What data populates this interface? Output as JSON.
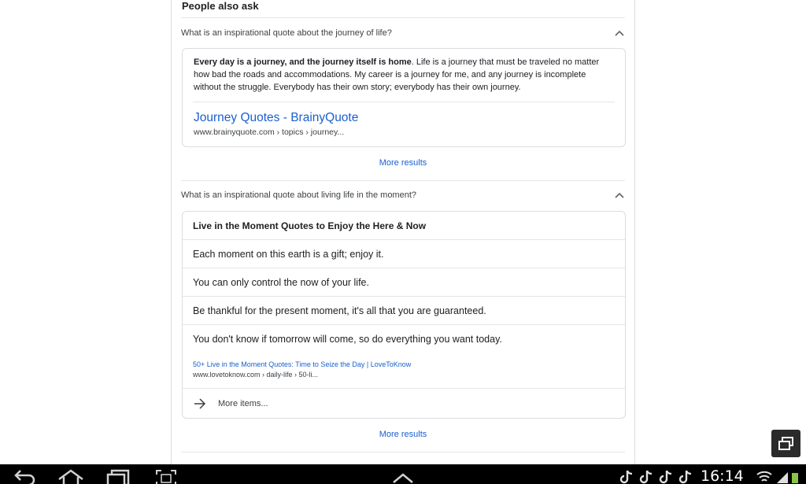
{
  "paa": {
    "title": "People also ask",
    "more_results_label": "More results",
    "q1": {
      "question": "What is an inspirational quote about the journey of life?",
      "snippet_bold": "Every day is a journey, and the journey itself is home",
      "snippet_rest": ". Life is a journey that must be traveled no matter how bad the roads and accommodations. My career is a journey for me, and any journey is incomplete without the struggle. Everybody has their own story; everybody has their own journey.",
      "source_title": "Journey Quotes - BrainyQuote",
      "source_url": "www.brainyquote.com › topics › journey..."
    },
    "q2": {
      "question": "What is an inspirational quote about living life in the moment?",
      "list_header": "Live in the Moment Quotes to Enjoy the Here & Now",
      "items": [
        "Each moment on this earth is a gift; enjoy it.",
        "You can only control the now of your life.",
        "Be thankful for the present moment, it's all that you are guaranteed.",
        "You don't know if tomorrow will come, so do everything you want today."
      ],
      "source_title": "50+ Live in the Moment Quotes: Time to Seize the Day | LoveToKnow",
      "source_url": "www.lovetoknow.com › daily-life › 50-li...",
      "more_items_label": "More items..."
    }
  },
  "status": {
    "time": "16:14"
  },
  "colors": {
    "link": "#1a5fcf",
    "navbar": "#000000",
    "battery": "#8bc34a"
  },
  "icons": [
    "chevron-up-icon",
    "arrow-right-icon",
    "recent-apps-float-icon",
    "back-icon",
    "home-icon",
    "recents-icon",
    "screenshot-icon",
    "up-arrow-icon",
    "tiktok-icon",
    "wifi-icon",
    "signal-icon"
  ]
}
